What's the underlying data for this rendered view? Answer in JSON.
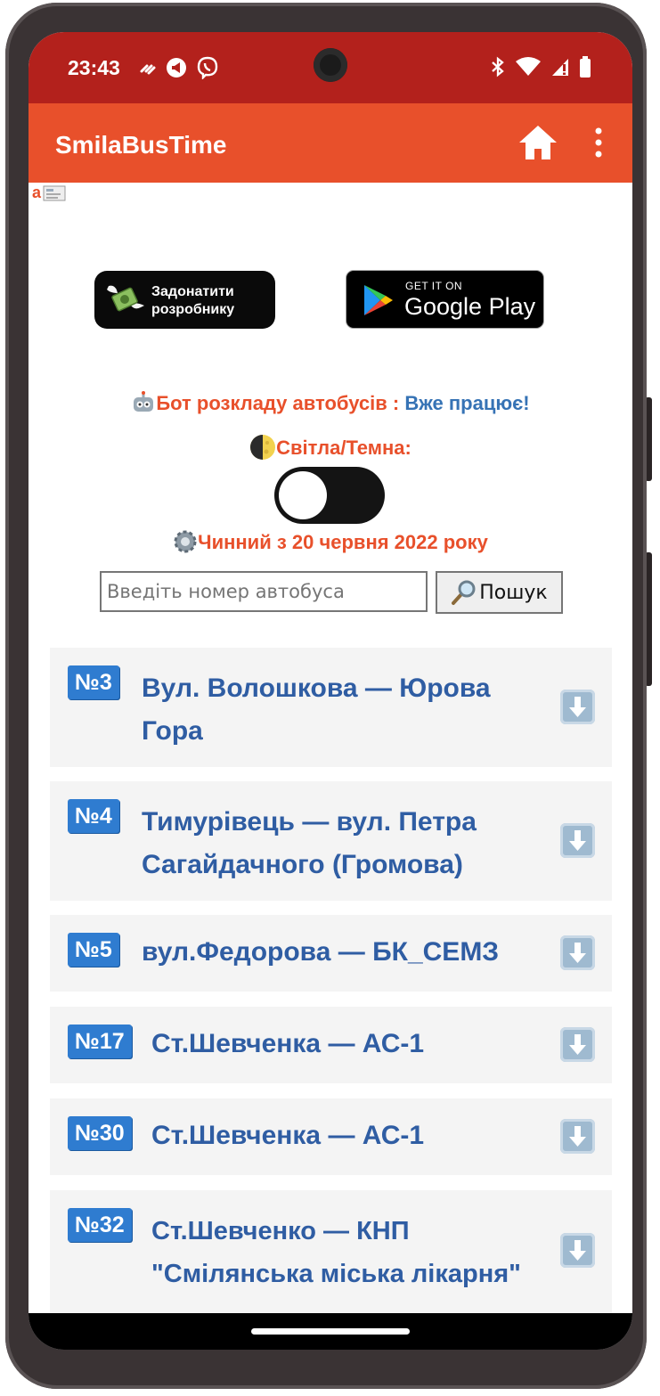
{
  "status": {
    "time": "23:43"
  },
  "app": {
    "title": "SmilaBusTime"
  },
  "broken_image": {
    "alt": "a"
  },
  "donate": {
    "label": "Задонатити розробнику"
  },
  "google_play": {
    "small": "GET IT ON",
    "big": "Google Play"
  },
  "bot": {
    "label": "Бот розкладу автобусів :",
    "status": "Вже працює!"
  },
  "theme": {
    "label": "Світла/Темна:",
    "toggle_on": false
  },
  "effective": {
    "label": "Чинний з 20 червня 2022 року"
  },
  "search": {
    "placeholder": "Введіть номер автобуса",
    "button": "Пошук"
  },
  "routes": [
    {
      "number": "№3",
      "name": "Вул. Волошкова — Юрова Гора"
    },
    {
      "number": "№4",
      "name": "Тимурівець — вул. Петра Сагайдачного  (Громова)"
    },
    {
      "number": "№5",
      "name": "вул.Федорова — БК_СЕМЗ"
    },
    {
      "number": "№17",
      "name": "Ст.Шевченка — АС-1"
    },
    {
      "number": "№30",
      "name": "Ст.Шевченка — АС-1"
    },
    {
      "number": "№32",
      "name": "Ст.Шевченко — КНП \"Смілянська міська лікарня\""
    }
  ],
  "colors": {
    "status_bar": "#b3211c",
    "app_bar": "#e8502b",
    "accent_orange": "#e8502b",
    "link_blue": "#3673b5",
    "badge_blue": "#2f7cd0",
    "route_text": "#2f5da3"
  }
}
